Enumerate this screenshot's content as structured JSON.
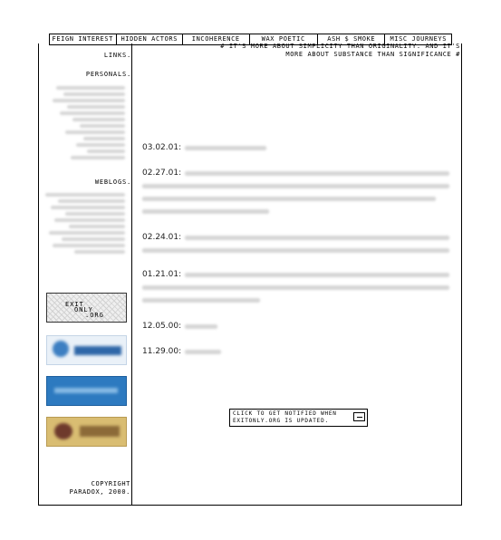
{
  "nav": {
    "items": [
      {
        "label": "FEIGN INTEREST"
      },
      {
        "label": "HIDDEN ACTORS"
      },
      {
        "label": "INCOHERENCE"
      },
      {
        "label": "WAX POETIC"
      },
      {
        "label": "ASH $ SMOKE"
      },
      {
        "label": "MISC JOURNEYS"
      }
    ]
  },
  "tagline": {
    "line1": "# IT'S MORE ABOUT SIMPLICITY THAN ORIGINALITY. AND IT'S",
    "line2": "MORE ABOUT SUBSTANCE THAN SIGNIFICANCE #"
  },
  "sidebar": {
    "links_heading": "LINKS.",
    "personals_heading": "PERSONALS.",
    "weblogs_heading": "WEBLOGS.",
    "badge_exit": {
      "line1": "EXIT",
      "line2": "ONLY",
      "line3": ".ORG"
    },
    "copyright_line1": "COPYRIGHT",
    "copyright_line2": "PARADOX, 2000."
  },
  "entries": [
    {
      "date": "03.02.01:"
    },
    {
      "date": "02.27.01:"
    },
    {
      "date": "02.24.01:"
    },
    {
      "date": "01.21.01:"
    },
    {
      "date": "12.05.00:"
    },
    {
      "date": "11.29.00:"
    }
  ],
  "notify": {
    "line1": "CLICK TO GET NOTIFIED WHEN",
    "line2": "EXITONLY.ORG IS UPDATED."
  }
}
